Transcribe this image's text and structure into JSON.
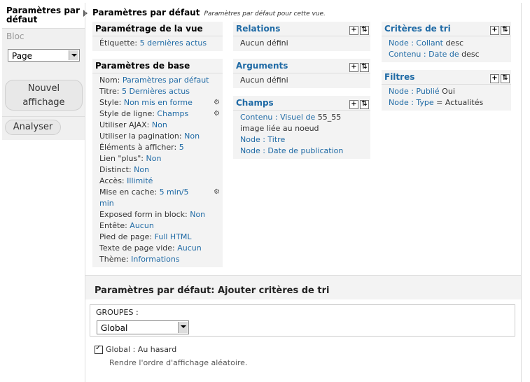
{
  "nav": {
    "active": "Paramètres par défaut",
    "bloc": "Bloc",
    "select": "Page",
    "add": "Nouvel affichage",
    "analyse": "Analyser"
  },
  "header": {
    "title": "Paramètres par défaut",
    "sub": "Paramètres par défaut pour cette vue."
  },
  "vue": {
    "title": "Paramétrage de la vue",
    "label": "Étiquette:",
    "value": "5 dernières actus"
  },
  "base": {
    "title": "Paramètres de base",
    "rows": [
      {
        "k": "Nom:",
        "v": "Paramètres par défaut"
      },
      {
        "k": "Titre:",
        "v": "5 Dernières actus"
      },
      {
        "k": "Style:",
        "v": "Non mis en forme"
      },
      {
        "k": "Style de ligne:",
        "v": "Champs"
      },
      {
        "k": "Utiliser AJAX:",
        "v": "Non"
      },
      {
        "k": "Utiliser la pagination:",
        "v": "Non"
      },
      {
        "k": "Éléments à afficher:",
        "v": "5"
      },
      {
        "k": "Lien \"plus\":",
        "v": "Non"
      },
      {
        "k": "Distinct:",
        "v": "Non"
      },
      {
        "k": "Accès:",
        "v": "Illimité"
      },
      {
        "k": "Mise en cache:",
        "v": "5 min/5",
        "v2": "min"
      },
      {
        "k": "Exposed form in block:",
        "v": "Non"
      },
      {
        "k": "Entête:",
        "v": "Aucun"
      },
      {
        "k": "Pied de page:",
        "v": "Full HTML"
      },
      {
        "k": "Texte de page vide:",
        "v": "Aucun"
      },
      {
        "k": "Thème:",
        "v": "Informations"
      }
    ]
  },
  "relations": {
    "title": "Relations",
    "empty": "Aucun défini"
  },
  "arguments": {
    "title": "Arguments",
    "empty": "Aucun défini"
  },
  "champs": {
    "title": "Champs",
    "r1a": "Contenu : Visuel de",
    "r1b": " 55_55",
    "r1c": "image liée au noeud",
    "r2": "Node : Titre",
    "r3": "Node : Date de publication"
  },
  "tri": {
    "title": "Critères de tri",
    "r1a": "Node : Collant",
    "r1b": " desc",
    "r2a": "Contenu : Date de",
    "r2b": " desc"
  },
  "filtres": {
    "title": "Filtres",
    "r1a": "Node : Publié",
    "r1b": " Oui",
    "r2a": "Node : Type",
    "r2b": " = Actualités"
  },
  "icons": {
    "add": "+",
    "sort": "⇅",
    "gear": "⚙"
  },
  "section2": {
    "title": "Paramètres par défaut: Ajouter critères de tri",
    "groups_label": "GROUPES :",
    "groups_value": "Global",
    "check_label": "Global : Au hasard",
    "check_desc": "Rendre l'ordre d'affichage aléatoire."
  }
}
